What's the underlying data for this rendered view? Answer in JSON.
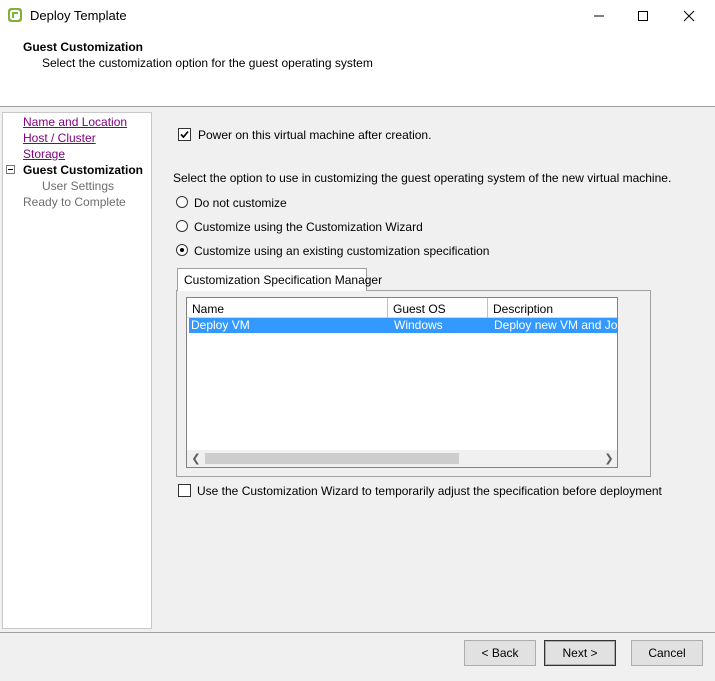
{
  "window": {
    "title": "Deploy Template",
    "icon": "vsphere-app-icon"
  },
  "header": {
    "title": "Guest Customization",
    "subtitle": "Select the customization option for the guest operating system"
  },
  "sidebar": {
    "items": [
      {
        "label": "Name and Location",
        "state": "link"
      },
      {
        "label": "Host / Cluster",
        "state": "link"
      },
      {
        "label": "Storage",
        "state": "link"
      },
      {
        "label": "Guest Customization",
        "state": "current"
      },
      {
        "label": "User Settings",
        "state": "disabled"
      },
      {
        "label": "Ready to Complete",
        "state": "disabled"
      }
    ]
  },
  "main": {
    "power_on_label": "Power on this virtual machine after creation.",
    "power_on_checked": true,
    "instruction": "Select the option to use in customizing the guest operating system of the new virtual machine.",
    "options": [
      {
        "label": "Do not customize",
        "selected": false
      },
      {
        "label": "Customize using the Customization Wizard",
        "selected": false
      },
      {
        "label": "Customize using an existing customization specification",
        "selected": true
      }
    ],
    "tab_label": "Customization Specification Manager",
    "table": {
      "columns": [
        "Name",
        "Guest OS",
        "Description"
      ],
      "rows": [
        {
          "name": "Deploy VM",
          "guest_os": "Windows",
          "description": "Deploy new VM and Join t",
          "selected": true
        }
      ]
    },
    "wizard_adjust_label": "Use the Customization Wizard to temporarily adjust the specification before deployment",
    "wizard_adjust_checked": false
  },
  "footer": {
    "back_label": "< Back",
    "next_label": "Next >",
    "cancel_label": "Cancel"
  },
  "colors": {
    "selection": "#3399ff",
    "link_visited": "#800080"
  }
}
